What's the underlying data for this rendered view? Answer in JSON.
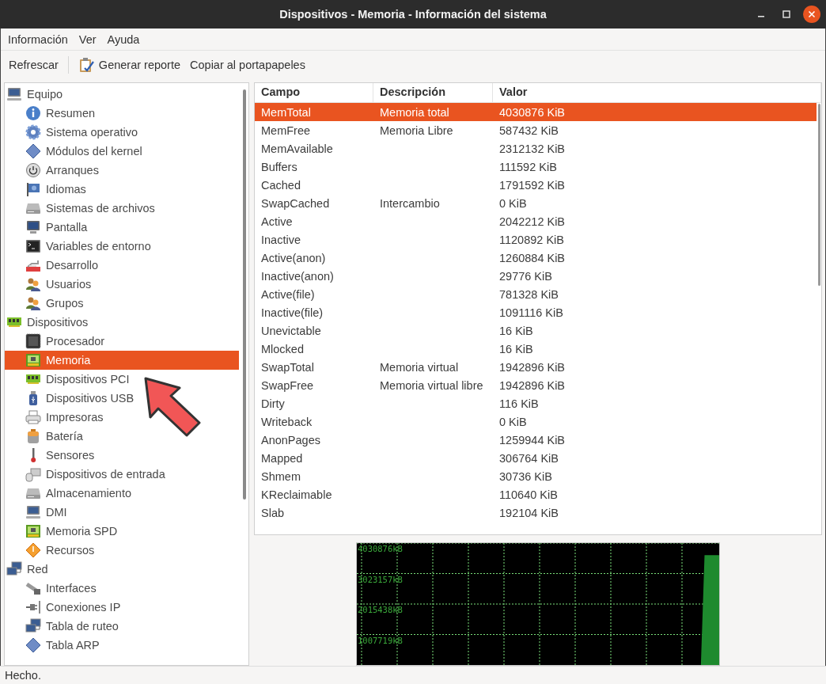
{
  "window": {
    "title": "Dispositivos - Memoria - Información del sistema"
  },
  "menu": [
    "Información",
    "Ver",
    "Ayuda"
  ],
  "toolbar": [
    {
      "label": "Refrescar",
      "kind": "text"
    },
    {
      "label": "Generar reporte",
      "kind": "report"
    },
    {
      "label": "Copiar al portapapeles",
      "kind": "text"
    }
  ],
  "sidebar": {
    "items": [
      {
        "label": "Equipo",
        "kind": "computer",
        "selected": false,
        "children": [
          {
            "label": "Resumen",
            "kind": "info",
            "selected": false
          },
          {
            "label": "Sistema operativo",
            "kind": "gear",
            "selected": false
          },
          {
            "label": "Módulos del kernel",
            "kind": "diamond",
            "selected": false
          },
          {
            "label": "Arranques",
            "kind": "power",
            "selected": false
          },
          {
            "label": "Idiomas",
            "kind": "flag",
            "selected": false
          },
          {
            "label": "Sistemas de archivos",
            "kind": "drive",
            "selected": false
          },
          {
            "label": "Pantalla",
            "kind": "monitor",
            "selected": false
          },
          {
            "label": "Variables de entorno",
            "kind": "terminal",
            "selected": false
          },
          {
            "label": "Desarrollo",
            "kind": "tool",
            "selected": false
          },
          {
            "label": "Usuarios",
            "kind": "users",
            "selected": false
          },
          {
            "label": "Grupos",
            "kind": "users",
            "selected": false
          }
        ]
      },
      {
        "label": "Dispositivos",
        "kind": "board",
        "selected": false,
        "children": [
          {
            "label": "Procesador",
            "kind": "chip",
            "selected": false
          },
          {
            "label": "Memoria",
            "kind": "memory",
            "selected": true
          },
          {
            "label": "Dispositivos PCI",
            "kind": "board",
            "selected": false
          },
          {
            "label": "Dispositivos USB",
            "kind": "usb",
            "selected": false
          },
          {
            "label": "Impresoras",
            "kind": "printer",
            "selected": false
          },
          {
            "label": "Batería",
            "kind": "battery",
            "selected": false
          },
          {
            "label": "Sensores",
            "kind": "thermometer",
            "selected": false
          },
          {
            "label": "Dispositivos de entrada",
            "kind": "input",
            "selected": false
          },
          {
            "label": "Almacenamiento",
            "kind": "drive",
            "selected": false
          },
          {
            "label": "DMI",
            "kind": "computer",
            "selected": false
          },
          {
            "label": "Memoria SPD",
            "kind": "memory",
            "selected": false
          },
          {
            "label": "Recursos",
            "kind": "warning",
            "selected": false
          }
        ]
      },
      {
        "label": "Red",
        "kind": "network",
        "selected": false,
        "children": [
          {
            "label": "Interfaces",
            "kind": "cable",
            "selected": false
          },
          {
            "label": "Conexiones IP",
            "kind": "plug",
            "selected": false
          },
          {
            "label": "Tabla de ruteo",
            "kind": "network",
            "selected": false
          },
          {
            "label": "Tabla ARP",
            "kind": "diamond",
            "selected": false
          }
        ]
      }
    ]
  },
  "table": {
    "columns": [
      "Campo",
      "Descripción",
      "Valor"
    ],
    "rows": [
      {
        "cells": [
          "MemTotal",
          "Memoria total",
          "4030876 KiB"
        ],
        "selected": true
      },
      {
        "cells": [
          "MemFree",
          "Memoria Libre",
          "587432 KiB"
        ],
        "selected": false
      },
      {
        "cells": [
          "MemAvailable",
          "",
          "2312132 KiB"
        ],
        "selected": false
      },
      {
        "cells": [
          "Buffers",
          "",
          "111592 KiB"
        ],
        "selected": false
      },
      {
        "cells": [
          "Cached",
          "",
          "1791592 KiB"
        ],
        "selected": false
      },
      {
        "cells": [
          "SwapCached",
          "Intercambio",
          "0 KiB"
        ],
        "selected": false
      },
      {
        "cells": [
          "Active",
          "",
          "2042212 KiB"
        ],
        "selected": false
      },
      {
        "cells": [
          "Inactive",
          "",
          "1120892 KiB"
        ],
        "selected": false
      },
      {
        "cells": [
          "Active(anon)",
          "",
          "1260884 KiB"
        ],
        "selected": false
      },
      {
        "cells": [
          "Inactive(anon)",
          "",
          "29776 KiB"
        ],
        "selected": false
      },
      {
        "cells": [
          "Active(file)",
          "",
          "781328 KiB"
        ],
        "selected": false
      },
      {
        "cells": [
          "Inactive(file)",
          "",
          "1091116 KiB"
        ],
        "selected": false
      },
      {
        "cells": [
          "Unevictable",
          "",
          "16 KiB"
        ],
        "selected": false
      },
      {
        "cells": [
          "Mlocked",
          "",
          "16 KiB"
        ],
        "selected": false
      },
      {
        "cells": [
          "SwapTotal",
          "Memoria virtual",
          "1942896 KiB"
        ],
        "selected": false
      },
      {
        "cells": [
          "SwapFree",
          "Memoria virtual libre",
          "1942896 KiB"
        ],
        "selected": false
      },
      {
        "cells": [
          "Dirty",
          "",
          "116 KiB"
        ],
        "selected": false
      },
      {
        "cells": [
          "Writeback",
          "",
          "0 KiB"
        ],
        "selected": false
      },
      {
        "cells": [
          "AnonPages",
          "",
          "1259944 KiB"
        ],
        "selected": false
      },
      {
        "cells": [
          "Mapped",
          "",
          "306764 KiB"
        ],
        "selected": false
      },
      {
        "cells": [
          "Shmem",
          "",
          "30736 KiB"
        ],
        "selected": false
      },
      {
        "cells": [
          "KReclaimable",
          "",
          "110640 KiB"
        ],
        "selected": false
      },
      {
        "cells": [
          "Slab",
          "",
          "192104 KiB"
        ],
        "selected": false
      }
    ]
  },
  "graph": {
    "chart_data": {
      "type": "area",
      "ylim": [
        0,
        4030876
      ],
      "yticks": [
        {
          "value": 4030876,
          "label": "4030876kB"
        },
        {
          "value": 3023157,
          "label": "3023157kB"
        },
        {
          "value": 2015438,
          "label": "2015438kB"
        },
        {
          "value": 1007719,
          "label": "1007719kB"
        }
      ],
      "grid": true,
      "series": [
        {
          "color": "#1e8a2e",
          "values": [
            0,
            0,
            0,
            0,
            0,
            0,
            0,
            0,
            0,
            0,
            0,
            0,
            0,
            0,
            0,
            0,
            0,
            0,
            0,
            0,
            0,
            0,
            0,
            0,
            0,
            0,
            0,
            0,
            0,
            0,
            0,
            0,
            0,
            0,
            0,
            0,
            0,
            0,
            0,
            0,
            0,
            0,
            0,
            0,
            0,
            0,
            0,
            0,
            0,
            0,
            0,
            0,
            0,
            0,
            0,
            0,
            0,
            0,
            0,
            0,
            0,
            0,
            0,
            0,
            0,
            0,
            0,
            0,
            0,
            0,
            0,
            0,
            0,
            0,
            0,
            0,
            0,
            0,
            0,
            0,
            0,
            0,
            0,
            0,
            0,
            0,
            0,
            0,
            0,
            0,
            0,
            0,
            0,
            0,
            0,
            3630000,
            3630000,
            3630000,
            3630000,
            3630000
          ]
        }
      ]
    }
  },
  "status_bar": "Hecho."
}
